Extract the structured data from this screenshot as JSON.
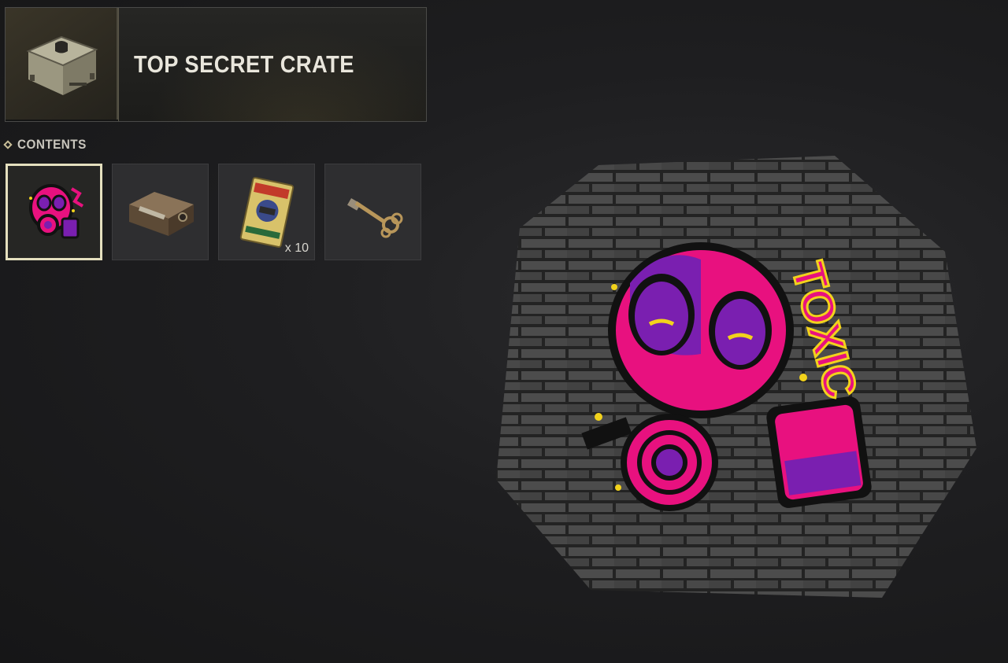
{
  "header": {
    "title": "TOP SECRET CRATE",
    "thumbnail_icon": "crate-icon"
  },
  "contents": {
    "label": "CONTENTS",
    "items": [
      {
        "icon": "gas-mask-spray-icon",
        "quantity": "",
        "selected": true
      },
      {
        "icon": "ammo-box-icon",
        "quantity": "",
        "selected": false
      },
      {
        "icon": "ticket-card-icon",
        "quantity": "x 10",
        "selected": false
      },
      {
        "icon": "key-icon",
        "quantity": "",
        "selected": false
      }
    ]
  },
  "preview": {
    "icon": "toxic-gas-mask-graffiti-icon",
    "graffiti_text": "TOXIC"
  },
  "colors": {
    "accent": "#e4dfbe",
    "magenta": "#e8117f",
    "purple": "#7a1fb0",
    "yellow": "#f2d21c"
  }
}
